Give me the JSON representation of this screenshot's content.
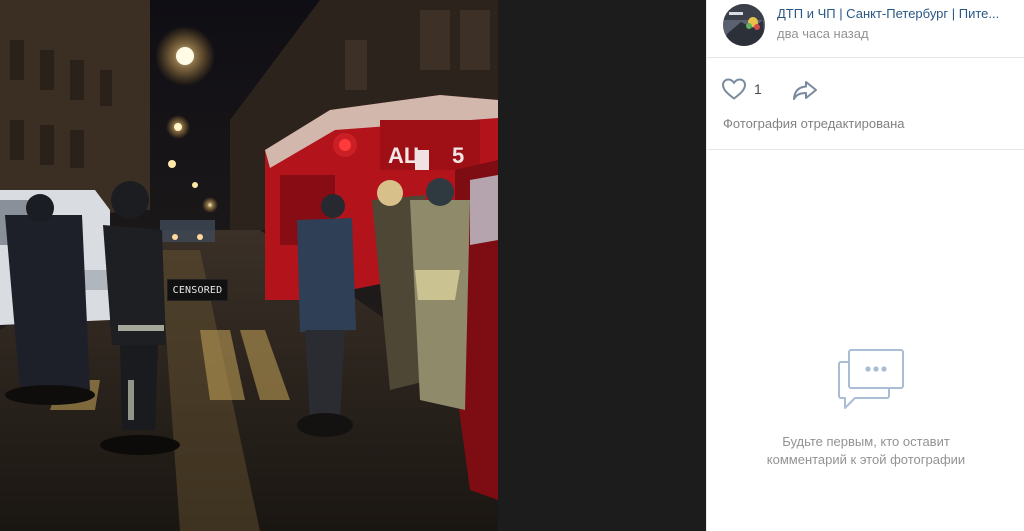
{
  "photo": {
    "overlay_label": "CENSORED",
    "truck_texts": {
      "plate": "АЦ",
      "number": "5"
    }
  },
  "author": {
    "name": "ДТП и ЧП | Санкт-Петербург | Пите...",
    "time": "два часа назад",
    "avatar_icon": "group-avatar"
  },
  "actions": {
    "like_icon": "heart-icon",
    "like_count": "1",
    "share_icon": "share-arrow-icon",
    "edited_note": "Фотография отредактирована"
  },
  "comments": {
    "empty_icon": "speech-bubbles-icon",
    "empty_line1": "Будьте первым, кто оставит",
    "empty_line2": "комментарий к этой фотографии"
  },
  "colors": {
    "link": "#2a5885",
    "muted": "#939393",
    "divider": "#e7e8ec",
    "viewer_bg": "#1c1c1c"
  }
}
